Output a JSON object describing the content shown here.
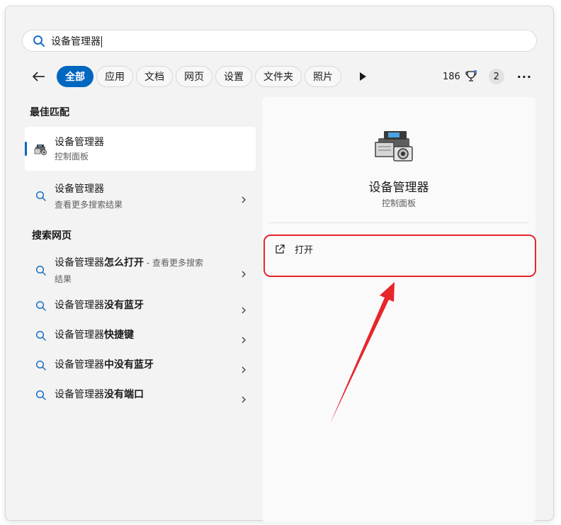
{
  "search": {
    "query": "设备管理器"
  },
  "filters": {
    "chips": [
      {
        "label": "全部",
        "active": true
      },
      {
        "label": "应用",
        "active": false
      },
      {
        "label": "文档",
        "active": false
      },
      {
        "label": "网页",
        "active": false
      },
      {
        "label": "设置",
        "active": false
      },
      {
        "label": "文件夹",
        "active": false
      },
      {
        "label": "照片",
        "active": false
      }
    ],
    "points": "186",
    "notification_count": "2",
    "more_label": "···"
  },
  "left": {
    "best_match_heading": "最佳匹配",
    "best_match": {
      "title": "设备管理器",
      "subtitle": "控制面板"
    },
    "more_results": {
      "title": "设备管理器",
      "subtitle": "查看更多搜索结果"
    },
    "web_heading": "搜索网页",
    "web_results": [
      {
        "prefix": "设备管理器",
        "bold": "怎么打开",
        "hint": " - 查看更多搜索",
        "line2": "结果"
      },
      {
        "prefix": "设备管理器",
        "bold": "没有蓝牙"
      },
      {
        "prefix": "设备管理器",
        "bold": "快捷键"
      },
      {
        "prefix": "设备管理器",
        "bold": "中没有蓝牙"
      },
      {
        "prefix": "设备管理器",
        "bold": "没有端口"
      }
    ]
  },
  "preview": {
    "title": "设备管理器",
    "subtitle": "控制面板",
    "open_label": "打开"
  },
  "colors": {
    "accent": "#0067c0",
    "annotation": "#e6262b"
  }
}
